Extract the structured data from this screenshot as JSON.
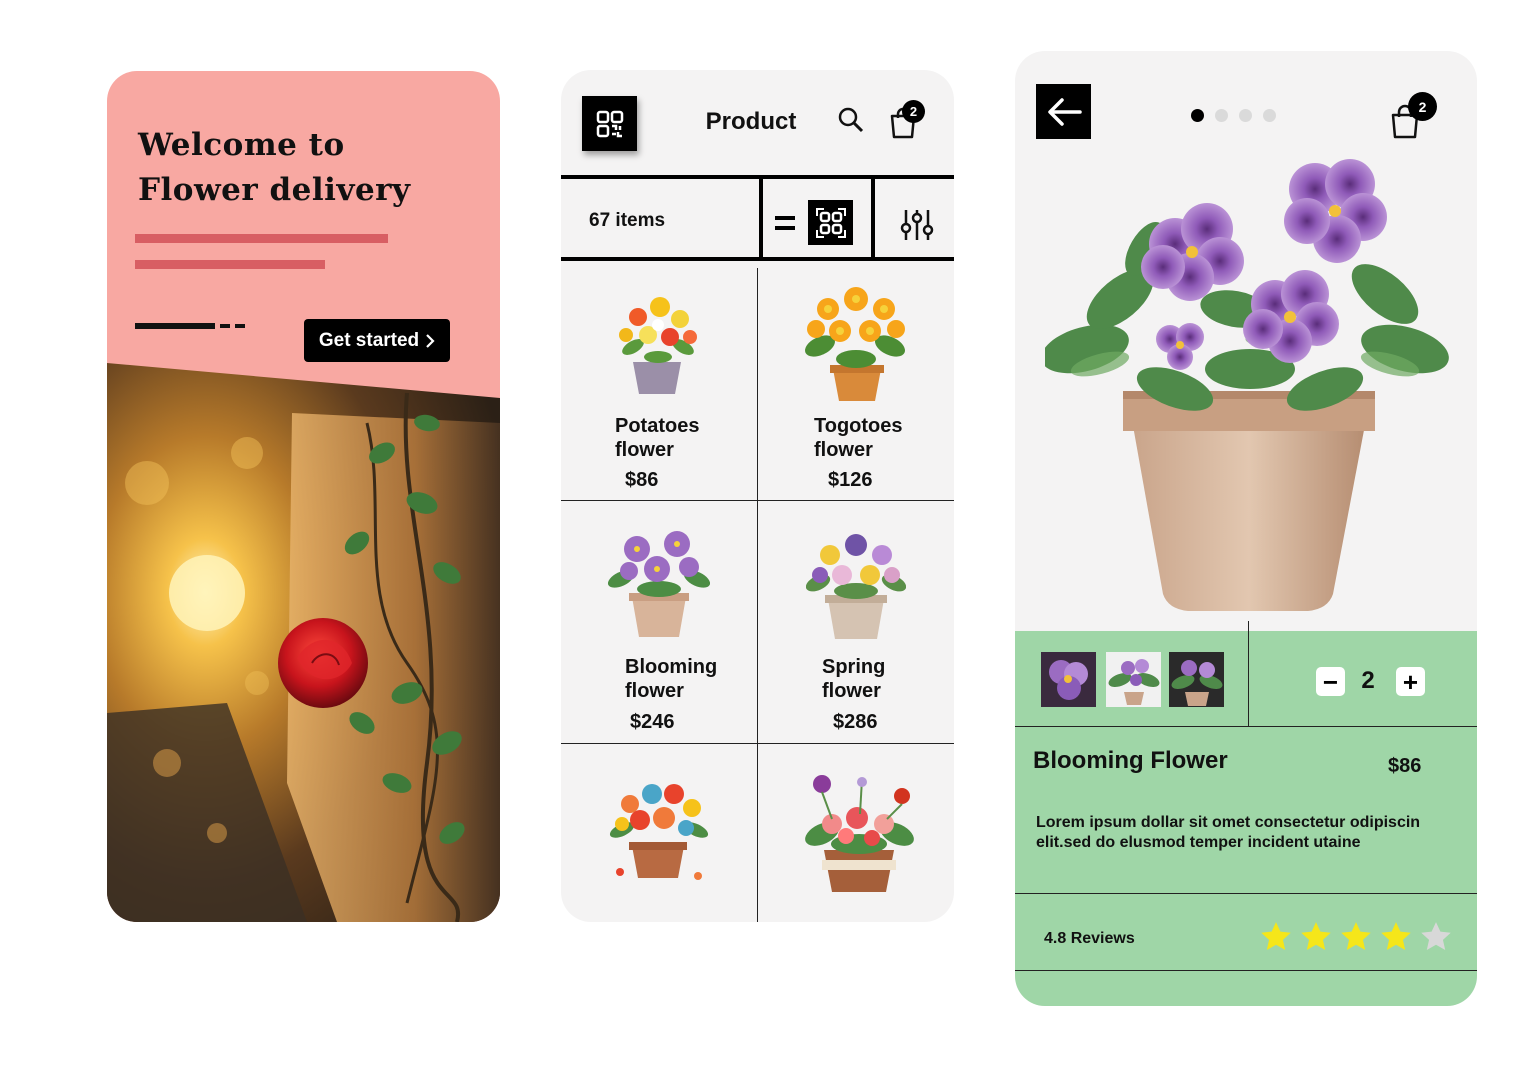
{
  "welcome_screen": {
    "title_line1": "Welcome to",
    "title_line2": "Flower delivery",
    "cta_label": "Get started",
    "cta_icon": "chevron-right-icon"
  },
  "product_screen": {
    "title": "Product",
    "cart_count": "2",
    "items_count": "67 items",
    "icons": [
      "qr-code-icon",
      "search-icon",
      "shopping-bag-icon",
      "list-view-icon",
      "grid-view-icon",
      "filter-sliders-icon"
    ],
    "products": [
      {
        "name_line1": "Potatoes",
        "name_line2": "flower",
        "price": "$86"
      },
      {
        "name_line1": "Togotoes",
        "name_line2": "flower",
        "price": "$126"
      },
      {
        "name_line1": "Blooming",
        "name_line2": "flower",
        "price": "$246"
      },
      {
        "name_line1": "Spring",
        "name_line2": "flower",
        "price": "$286"
      },
      {
        "name_line1": "",
        "name_line2": "",
        "price": ""
      },
      {
        "name_line1": "",
        "name_line2": "",
        "price": ""
      }
    ]
  },
  "detail_screen": {
    "cart_count": "2",
    "carousel_active_index": 0,
    "carousel_total": 4,
    "quantity": "2",
    "decrement_label": "−",
    "increment_label": "+",
    "product_name": "Blooming Flower",
    "price": "$86",
    "description": "Lorem ipsum dollar sit omet consectetur odipiscin elit.sed do elusmod temper incident utaine",
    "reviews_label": "4.8 Reviews",
    "rating_stars_filled": 4,
    "rating_stars_total": 5
  },
  "colors": {
    "welcome_bg": "#f8a8a2",
    "accent_lines": "#d85e63",
    "detail_green": "#9fd6a7",
    "screen_bg": "#f4f3f3",
    "star_filled": "#f5e61a",
    "star_empty": "#d8d8d8"
  }
}
